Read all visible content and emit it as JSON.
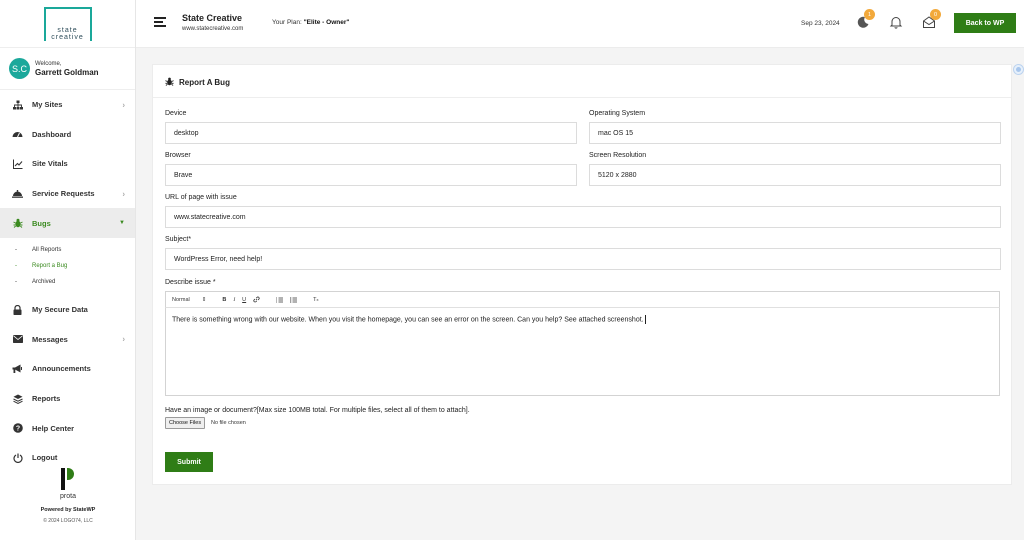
{
  "sidebar": {
    "logo_line1": "state",
    "logo_line2": "creative",
    "welcome_label": "Welcome,",
    "user_name": "Garrett Goldman",
    "avatar_initials": "S.C",
    "items": [
      {
        "label": "My Sites",
        "icon": "sitemap-icon",
        "has_arrow": true
      },
      {
        "label": "Dashboard",
        "icon": "gauge-icon",
        "has_arrow": false
      },
      {
        "label": "Site Vitals",
        "icon": "chart-line-icon",
        "has_arrow": false
      },
      {
        "label": "Service Requests",
        "icon": "bell-service-icon",
        "has_arrow": true
      },
      {
        "label": "Bugs",
        "icon": "bug-icon",
        "has_arrow": true,
        "active": true
      },
      {
        "label": "My Secure Data",
        "icon": "lock-icon",
        "has_arrow": false
      },
      {
        "label": "Messages",
        "icon": "envelope-icon",
        "has_arrow": true
      },
      {
        "label": "Announcements",
        "icon": "bullhorn-icon",
        "has_arrow": false
      },
      {
        "label": "Reports",
        "icon": "layers-icon",
        "has_arrow": false
      },
      {
        "label": "Help Center",
        "icon": "question-circle-icon",
        "has_arrow": false
      },
      {
        "label": "Logout",
        "icon": "power-icon",
        "has_arrow": false
      }
    ],
    "bugs_sub": [
      {
        "label": "All Reports"
      },
      {
        "label": "Report a Bug",
        "current": true
      },
      {
        "label": "Archived"
      }
    ],
    "prota_word": "prota",
    "powered_by": "Powered by StateWP",
    "copyright": "© 2024 LOGO74, LLC"
  },
  "header": {
    "site_title": "State Creative",
    "site_url": "www.statecreative.com",
    "plan_label": "Your Plan: ",
    "plan_value": "\"Elite - Owner\"",
    "date": "Sep 23, 2024",
    "badge_moon": "1",
    "badge_inbox": "0",
    "back_button": "Back to WP"
  },
  "form": {
    "title": "Report A Bug",
    "device_label": "Device",
    "device_value": "desktop",
    "os_label": "Operating System",
    "os_value": "mac OS 15",
    "browser_label": "Browser",
    "browser_value": "Brave",
    "resolution_label": "Screen Resolution",
    "resolution_value": "5120 x 2880",
    "url_label": "URL of page with issue",
    "url_value": "www.statecreative.com",
    "subject_label": "Subject*",
    "subject_value": "WordPress Error, need help!",
    "describe_label": "Describe issue *",
    "toolbar_format": "Normal",
    "describe_value": "There is something wrong with our website. When you visit the homepage, you can see an error on the screen. Can you help? See attached screenshot.",
    "upload_label": "Have an image or document?[Max size 100MB total. For multiple files, select all of them to attach].",
    "choose_files": "Choose Files",
    "no_file": "No file chosen",
    "submit": "Submit"
  },
  "colors": {
    "accent_green": "#2f7d16",
    "teal": "#1aa89a",
    "badge_orange": "#f2a93b"
  }
}
